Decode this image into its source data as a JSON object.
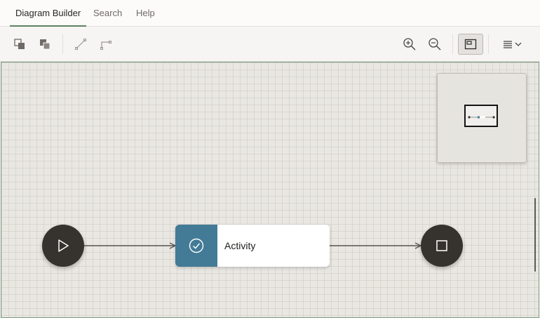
{
  "tabs": [
    {
      "label": "Diagram Builder",
      "active": true
    },
    {
      "label": "Search",
      "active": false
    },
    {
      "label": "Help",
      "active": false
    }
  ],
  "toolbar": {
    "left_tools": [
      {
        "icon": "arrange-back-icon",
        "tooltip": ""
      },
      {
        "icon": "arrange-front-icon",
        "tooltip": ""
      },
      {
        "icon": "straight-connector-icon",
        "tooltip": ""
      },
      {
        "icon": "elbow-connector-icon",
        "tooltip": ""
      }
    ],
    "right_tools": [
      {
        "icon": "zoom-in-icon"
      },
      {
        "icon": "zoom-out-icon"
      },
      {
        "icon": "overview-toggle-icon",
        "pressed": true
      },
      {
        "icon": "menu-icon",
        "has_dropdown": true
      }
    ]
  },
  "diagram": {
    "nodes": [
      {
        "id": "start",
        "type": "start",
        "icon": "play-icon"
      },
      {
        "id": "activity",
        "type": "activity",
        "label": "Activity",
        "icon": "check-circle-icon"
      },
      {
        "id": "end",
        "type": "end",
        "icon": "stop-icon"
      }
    ],
    "edges": [
      {
        "from": "start",
        "to": "activity"
      },
      {
        "from": "activity",
        "to": "end"
      }
    ]
  },
  "colors": {
    "accent": "#5e8361",
    "node_dark": "#36322e",
    "activity_teal": "#437a96",
    "canvas_bg": "#e9e7e2"
  }
}
